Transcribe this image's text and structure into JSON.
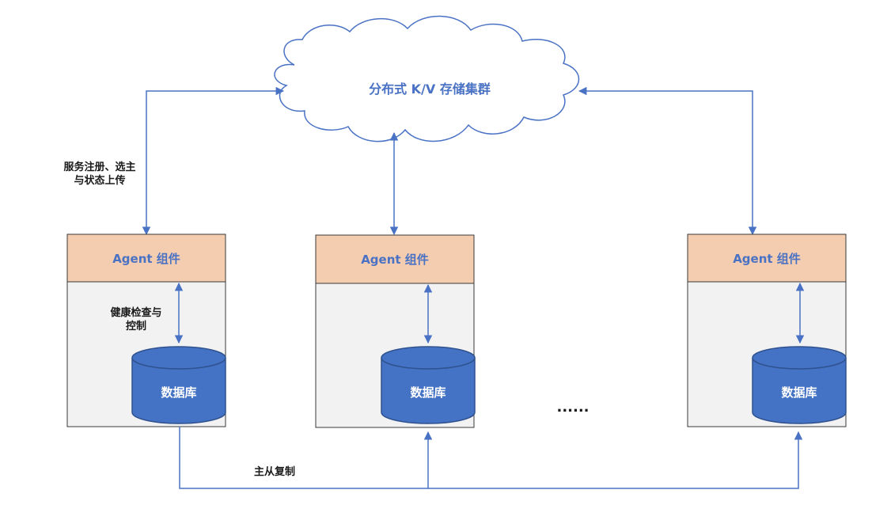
{
  "cluster": {
    "label": "分布式 K/V 存储集群"
  },
  "labels": {
    "register_line1": "服务注册、选主",
    "register_line2": "与状态上传",
    "health_line1": "健康检查与",
    "health_line2": "控制",
    "replication": "主从复制",
    "ellipsis": "......"
  },
  "nodes": [
    {
      "agent_label": "Agent 组件",
      "db_label": "数据库"
    },
    {
      "agent_label": "Agent 组件",
      "db_label": "数据库"
    },
    {
      "agent_label": "Agent 组件",
      "db_label": "数据库"
    }
  ],
  "colors": {
    "line": "#4a72c4",
    "agent_fill": "#f4ccaf",
    "node_fill": "#f2f2f2",
    "node_border": "#3a3a3a",
    "db_fill": "#4472c4",
    "db_stroke": "#2f528f",
    "cloud_stroke": "#4a72c4",
    "cluster_text": "#4a72c4",
    "agent_text": "#4a72c4"
  }
}
